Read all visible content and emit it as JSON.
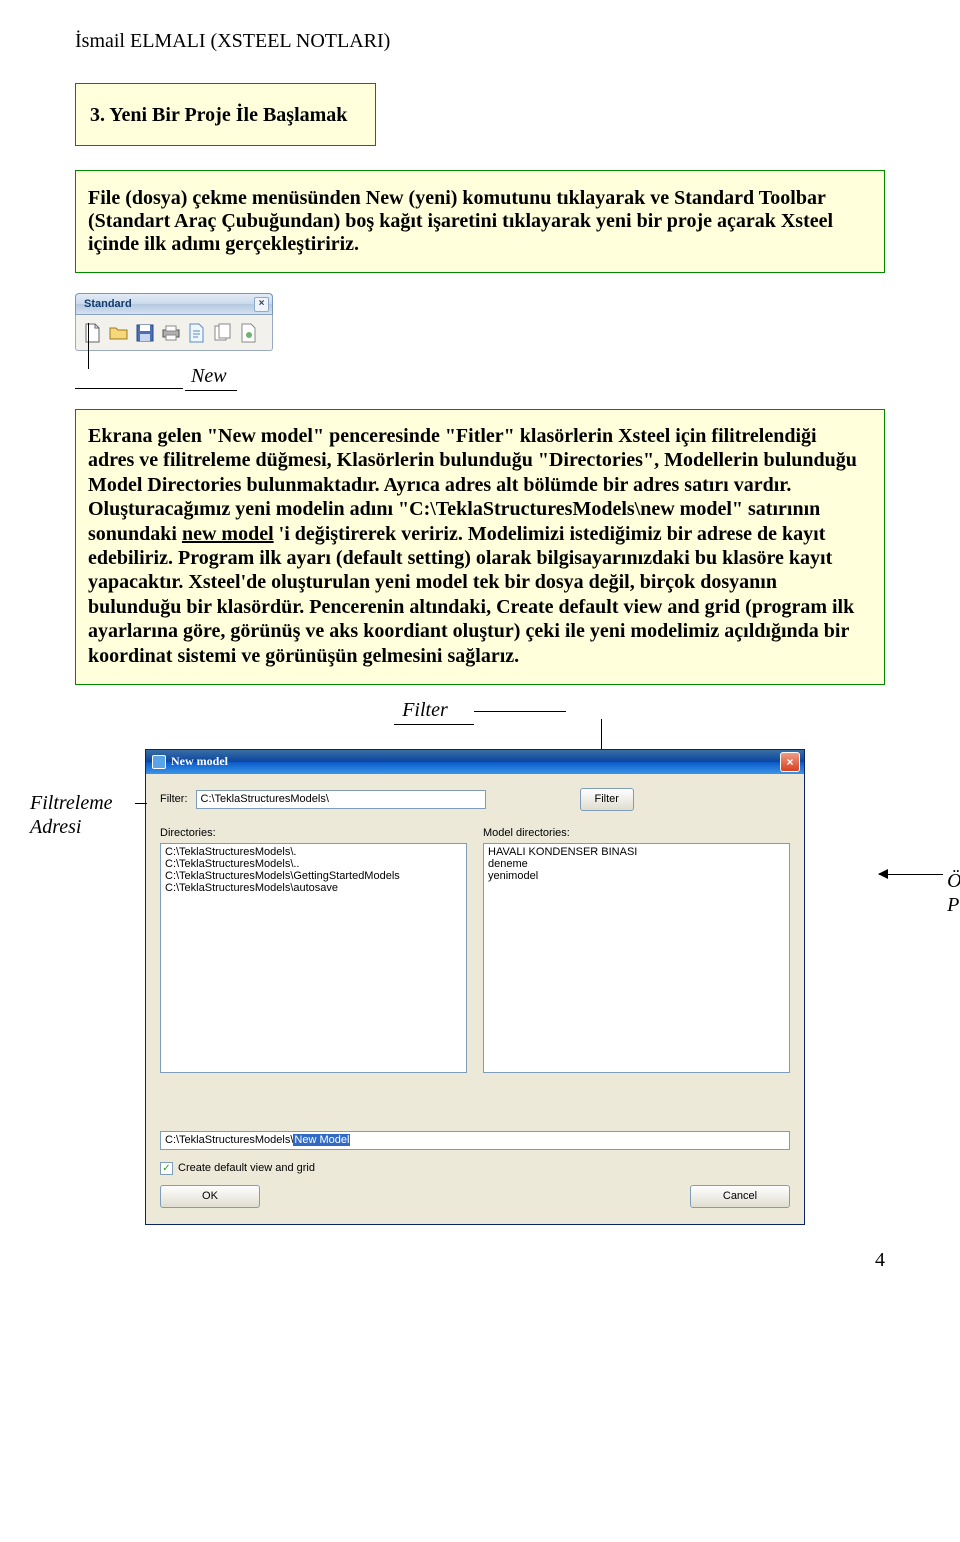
{
  "header": "İsmail ELMALI (XSTEEL NOTLARI)",
  "heading_box": "3. Yeni Bir Proje İle Başlamak",
  "p1": "File (dosya) çekme menüsünden New (yeni) komutunu tıklayarak ve Standard Toolbar (Standart Araç Çubuğundan) boş kağıt işaretini tıklayarak yeni bir proje açarak Xsteel içinde ilk adımı gerçekleştiririz.",
  "standard_toolbar": {
    "title": "Standard",
    "idx_hint": "7 icons: new, open, save, print, cut, copy, paste"
  },
  "new_label": "New",
  "p2_pre": "Ekrana gelen \"New model\" penceresinde \"Fitler\" klasörlerin Xsteel için filitrelendiği adres ve filitreleme düğmesi, Klasörlerin bulunduğu \"Directories\", Modellerin bulunduğu Model Directories bulunmaktadır. Ayrıca adres alt bölümde bir adres satırı vardır. Oluşturacağımız yeni modelin adını \"",
  "p2_bold1": "C:\\TeklaStructuresModels\\new model",
  "p2_mid": "\" satırının sonundaki ",
  "p2_ul": "new model",
  "p2_post": " 'i değiştirerek veririz. Modelimizi istediğimiz bir adrese de kayıt edebiliriz. Program ilk ayarı (default setting) olarak bilgisayarınızdaki bu klasöre  kayıt yapacaktır. Xsteel'de oluşturulan yeni model tek bir dosya değil, birçok dosyanın bulunduğu bir klasördür. Pencerenin altındaki, Create default view and grid (program ilk ayarlarına göre, görünüş ve aks koordiant oluştur) çeki ile yeni modelimiz açıldığında bir koordinat sistemi ve görünüşün gelmesini sağlarız.",
  "filter_label": "Filter",
  "side_left": {
    "l1": "Filtreleme",
    "l2": "Adresi"
  },
  "side_right": {
    "l1": "Önceki",
    "l2": "Projeler"
  },
  "dialog": {
    "title": "New model",
    "filter_label": "Filter:",
    "filter_value": "C:\\TeklaStructuresModels\\",
    "filter_btn": "Filter",
    "directories_label": "Directories:",
    "model_dirs_label": "Model directories:",
    "directories": [
      "C:\\TeklaStructuresModels\\.",
      "C:\\TeklaStructuresModels\\..",
      "C:\\TeklaStructuresModels\\GettingStartedModels",
      "C:\\TeklaStructuresModels\\autosave"
    ],
    "model_dirs": [
      "HAVALI KONDENSER BINASI",
      "deneme",
      "yenimodel"
    ],
    "path_prefix": "C:\\TeklaStructuresModels\\",
    "path_selected": "New Model",
    "checkbox_label": "Create default view and grid",
    "ok": "OK",
    "cancel": "Cancel"
  },
  "page": "4"
}
